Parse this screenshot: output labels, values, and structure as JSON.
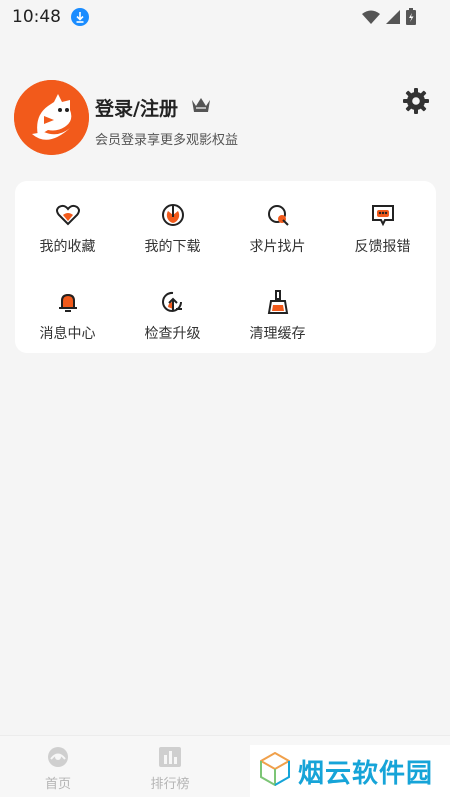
{
  "status_bar": {
    "time": "10:48",
    "icons": [
      "download-icon",
      "wifi-icon",
      "signal-icon",
      "battery-icon"
    ]
  },
  "profile": {
    "title": "登录/注册",
    "subtitle": "会员登录享更多观影权益",
    "icons": [
      "avatar",
      "crown-icon",
      "gear-icon"
    ]
  },
  "menu": {
    "items": [
      {
        "label": "我的收藏",
        "icon": "heart-icon"
      },
      {
        "label": "我的下载",
        "icon": "download-circle-icon"
      },
      {
        "label": "求片找片",
        "icon": "search-icon"
      },
      {
        "label": "反馈报错",
        "icon": "feedback-icon"
      },
      {
        "label": "消息中心",
        "icon": "bell-icon"
      },
      {
        "label": "检查升级",
        "icon": "upgrade-icon"
      },
      {
        "label": "清理缓存",
        "icon": "broom-icon"
      }
    ]
  },
  "tabbar": {
    "tabs": [
      {
        "label": "首页",
        "icon": "home-icon"
      },
      {
        "label": "排行榜",
        "icon": "chart-icon"
      }
    ]
  },
  "watermark": {
    "text": "烟云软件园"
  },
  "colors": {
    "accent": "#f25a1b",
    "background": "#f5f5f5",
    "card": "#ffffff",
    "watermark": "#16a4d8"
  }
}
